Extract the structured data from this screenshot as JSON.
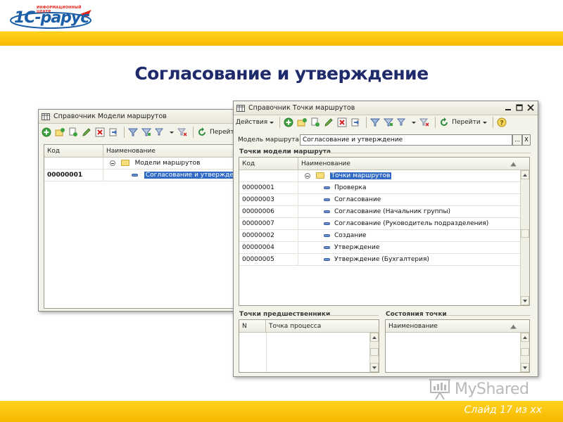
{
  "brand": {
    "logo_small_text": "ИНФОРМАЦИОННЫЙ ЦЕНТР",
    "logo_text": "1С-рарус",
    "accent_yellow": "#f7b800",
    "brand_blue": "#1b5fa8",
    "brand_red": "#e2231a"
  },
  "slide": {
    "title": "Согласование и утверждение",
    "counter": "Слайд 17 из xx",
    "watermark": "MyShared"
  },
  "window_back": {
    "title": "Справочник Модели маршрутов",
    "toolbar_goto": "Перейти",
    "columns": [
      "Код",
      "Наименование"
    ],
    "group_row": {
      "name": "Модели маршрутов"
    },
    "rows": [
      {
        "code": "00000001",
        "name": "Согласование и утверждение"
      }
    ]
  },
  "window_front": {
    "title": "Справочник Точки маршрутов",
    "toolbar": {
      "actions": "Действия",
      "goto": "Перейти"
    },
    "model_label": "Модель маршрута:",
    "model_value": "Согласование и утверждение",
    "model_btn_select": "...",
    "model_btn_clear": "X",
    "points_section": "Точки модели маршрута",
    "columns": [
      "Код",
      "Наименование"
    ],
    "group_row": {
      "name": "Точки маршрутов"
    },
    "rows": [
      {
        "code": "00000001",
        "name": "Проверка"
      },
      {
        "code": "00000003",
        "name": "Согласование"
      },
      {
        "code": "00000006",
        "name": "Согласование (Начальник группы)"
      },
      {
        "code": "00000007",
        "name": "Согласование (Руководитель подразделения)"
      },
      {
        "code": "00000002",
        "name": "Создание"
      },
      {
        "code": "00000004",
        "name": "Утверждение"
      },
      {
        "code": "00000005",
        "name": "Утверждение (Бухгалтерия)"
      }
    ],
    "predecessors_section": "Точки предшественники",
    "predecessors_columns": [
      "N",
      "Точка процесса"
    ],
    "states_section": "Состояния точки",
    "states_columns": [
      "Наименование"
    ]
  }
}
